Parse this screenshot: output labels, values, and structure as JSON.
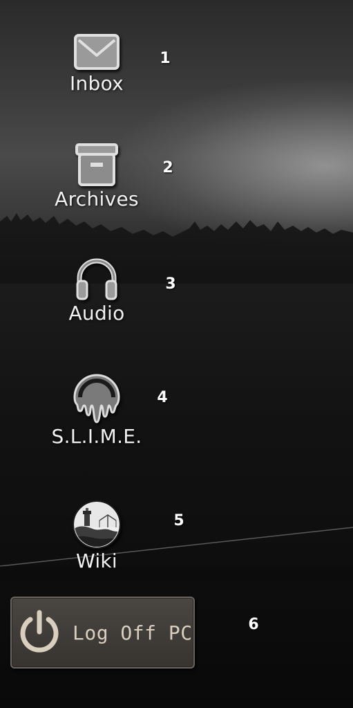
{
  "desktop_icons": [
    {
      "label": "Inbox",
      "icon": "envelope-icon",
      "number": "1"
    },
    {
      "label": "Archives",
      "icon": "archive-box-icon",
      "number": "2"
    },
    {
      "label": "Audio",
      "icon": "headphones-icon",
      "number": "3"
    },
    {
      "label": "S.L.I.M.E.",
      "icon": "slime-drip-icon",
      "number": "4"
    },
    {
      "label": "Wiki",
      "icon": "wiki-lighthouse-icon",
      "number": "5"
    }
  ],
  "logoff": {
    "label": "Log Off PC",
    "icon": "power-icon",
    "number": "6"
  },
  "colors": {
    "icon_metal": "#c9c9c9",
    "label_text": "#f2f2f2",
    "button_bg": "#403c39",
    "button_text": "#d8cfbf"
  }
}
